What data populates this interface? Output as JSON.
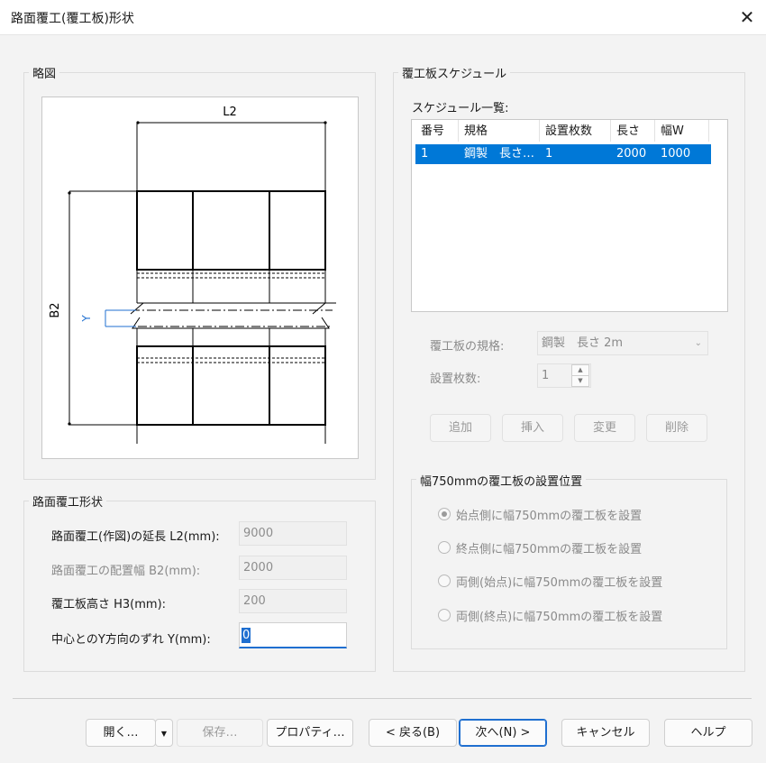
{
  "window": {
    "title": "路面覆工(覆工板)形状",
    "close_icon": "✕"
  },
  "sketch": {
    "group_label": "略図",
    "dim_l2": "L2",
    "dim_b2": "B2",
    "dim_y": "Y"
  },
  "shape": {
    "group_label": "路面覆工形状",
    "fields": [
      {
        "label": "路面覆工(作図)の延長 L2(mm):",
        "value": "9000",
        "disabled": false
      },
      {
        "label": "路面覆工の配置幅 B2(mm):",
        "value": "2000",
        "disabled": true
      },
      {
        "label": "覆工板高さ H3(mm):",
        "value": "200",
        "disabled": false
      },
      {
        "label": "中心とのY方向のずれ Y(mm):",
        "value": "0",
        "disabled": false
      }
    ]
  },
  "schedule": {
    "group_label": "覆工板スケジュール",
    "list_label": "スケジュール一覧:",
    "columns": [
      "番号",
      "規格",
      "設置枚数",
      "長さ",
      "幅W"
    ],
    "rows": [
      [
        "1",
        "鋼製　長さ…",
        "1",
        "2000",
        "1000"
      ]
    ],
    "spec_label": "覆工板の規格:",
    "spec_value": "鋼製　長さ 2m",
    "count_label": "設置枚数:",
    "count_value": "1",
    "buttons": {
      "add": "追加",
      "insert": "挿入",
      "change": "変更",
      "delete": "削除"
    }
  },
  "position": {
    "group_label": "幅750mmの覆工板の設置位置",
    "options": [
      {
        "label": "始点側に幅750mmの覆工板を設置",
        "checked": true
      },
      {
        "label": "終点側に幅750mmの覆工板を設置",
        "checked": false
      },
      {
        "label": "両側(始点)に幅750mmの覆工板を設置",
        "checked": false
      },
      {
        "label": "両側(終点)に幅750mmの覆工板を設置",
        "checked": false
      }
    ]
  },
  "footer": {
    "open": "開く…",
    "save": "保存…",
    "properties": "プロパティ…",
    "back": "< 戻る(B)",
    "next": "次へ(N) >",
    "cancel": "キャンセル",
    "help": "ヘルプ"
  },
  "colors": {
    "accent": "#0078d7",
    "dim_blue": "#1f6fd0"
  }
}
